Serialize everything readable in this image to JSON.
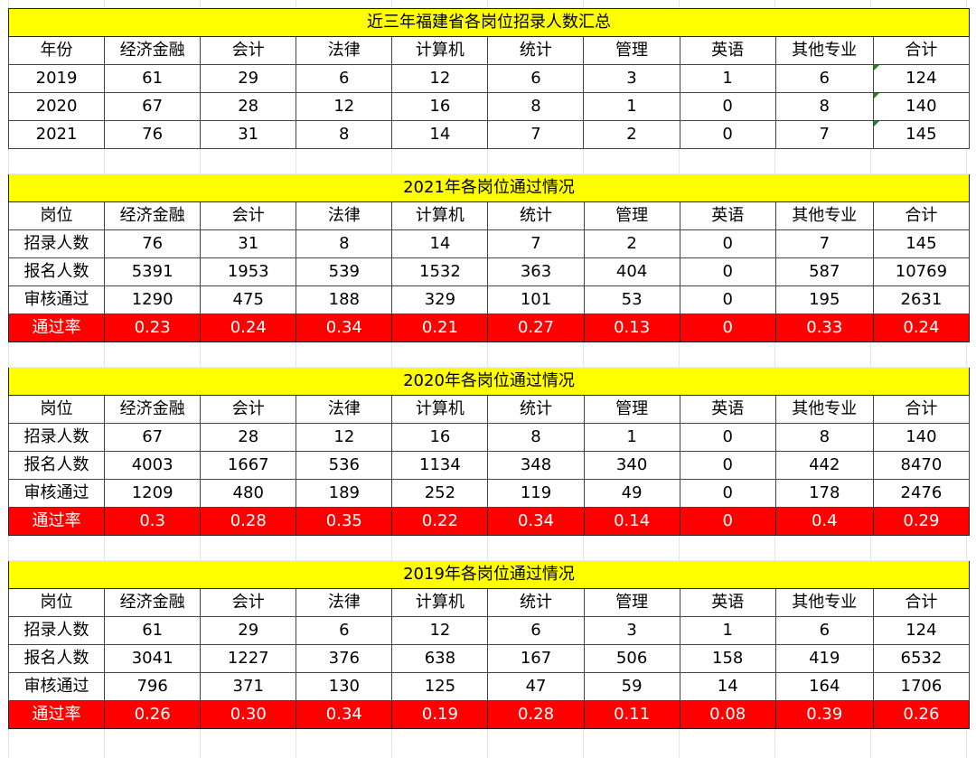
{
  "summary": {
    "title": "近三年福建省各岗位招录人数汇总",
    "headers": [
      "年份",
      "经济金融",
      "会计",
      "法律",
      "计算机",
      "统计",
      "管理",
      "英语",
      "其他专业",
      "合计"
    ],
    "rows": [
      [
        "2019",
        "61",
        "29",
        "6",
        "12",
        "6",
        "3",
        "1",
        "6",
        "124"
      ],
      [
        "2020",
        "67",
        "28",
        "12",
        "16",
        "8",
        "1",
        "0",
        "8",
        "140"
      ],
      [
        "2021",
        "76",
        "31",
        "8",
        "14",
        "7",
        "2",
        "0",
        "7",
        "145"
      ]
    ]
  },
  "blocks": [
    {
      "title": "2021年各岗位通过情况",
      "headers": [
        "岗位",
        "经济金融",
        "会计",
        "法律",
        "计算机",
        "统计",
        "管理",
        "英语",
        "其他专业",
        "合计"
      ],
      "rows": [
        [
          "招录人数",
          "76",
          "31",
          "8",
          "14",
          "7",
          "2",
          "0",
          "7",
          "145"
        ],
        [
          "报名人数",
          "5391",
          "1953",
          "539",
          "1532",
          "363",
          "404",
          "0",
          "587",
          "10769"
        ],
        [
          "审核通过",
          "1290",
          "475",
          "188",
          "329",
          "101",
          "53",
          "0",
          "195",
          "2631"
        ]
      ],
      "rate": [
        "通过率",
        "0.23",
        "0.24",
        "0.34",
        "0.21",
        "0.27",
        "0.13",
        "0",
        "0.33",
        "0.24"
      ]
    },
    {
      "title": "2020年各岗位通过情况",
      "headers": [
        "岗位",
        "经济金融",
        "会计",
        "法律",
        "计算机",
        "统计",
        "管理",
        "英语",
        "其他专业",
        "合计"
      ],
      "rows": [
        [
          "招录人数",
          "67",
          "28",
          "12",
          "16",
          "8",
          "1",
          "0",
          "8",
          "140"
        ],
        [
          "报名人数",
          "4003",
          "1667",
          "536",
          "1134",
          "348",
          "340",
          "0",
          "442",
          "8470"
        ],
        [
          "审核通过",
          "1209",
          "480",
          "189",
          "252",
          "119",
          "49",
          "0",
          "178",
          "2476"
        ]
      ],
      "rate": [
        "通过率",
        "0.3",
        "0.28",
        "0.35",
        "0.22",
        "0.34",
        "0.14",
        "0",
        "0.4",
        "0.29"
      ]
    },
    {
      "title": "2019年各岗位通过情况",
      "headers": [
        "岗位",
        "经济金融",
        "会计",
        "法律",
        "计算机",
        "统计",
        "管理",
        "英语",
        "其他专业",
        "合计"
      ],
      "rows": [
        [
          "招录人数",
          "61",
          "29",
          "6",
          "12",
          "6",
          "3",
          "1",
          "6",
          "124"
        ],
        [
          "报名人数",
          "3041",
          "1227",
          "376",
          "638",
          "167",
          "506",
          "158",
          "419",
          "6532"
        ],
        [
          "审核通过",
          "796",
          "371",
          "130",
          "125",
          "47",
          "59",
          "14",
          "164",
          "1706"
        ]
      ],
      "rate": [
        "通过率",
        "0.26",
        "0.30",
        "0.34",
        "0.19",
        "0.28",
        "0.11",
        "0.08",
        "0.39",
        "0.26"
      ]
    }
  ],
  "colors": {
    "title_fill": "#ffff00",
    "rate_fill": "#ff0000",
    "rate_text": "#ffffff",
    "comment_flag": "#1a8a1a"
  }
}
